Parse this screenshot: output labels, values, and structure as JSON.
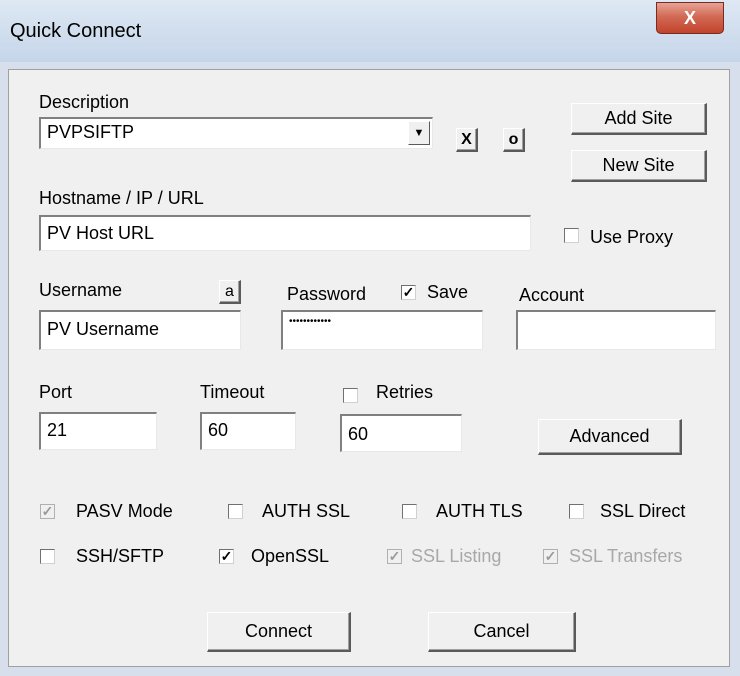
{
  "window": {
    "title": "Quick Connect",
    "close_glyph": "X"
  },
  "description": {
    "label": "Description",
    "value": "PVPSIFTP",
    "delete_label": "X",
    "other_label": "o"
  },
  "buttons": {
    "add_site": "Add Site",
    "new_site": "New Site",
    "advanced": "Advanced",
    "connect": "Connect",
    "cancel": "Cancel",
    "user_a": "a"
  },
  "hostname": {
    "label": "Hostname / IP / URL",
    "value": "PV Host URL",
    "use_proxy_label": "Use Proxy",
    "use_proxy_checked": false
  },
  "credentials": {
    "username_label": "Username",
    "username_value": "PV Username",
    "password_label": "Password",
    "password_value": "••••••••••••",
    "save_label": "Save",
    "save_checked": true,
    "account_label": "Account",
    "account_value": ""
  },
  "connection": {
    "port_label": "Port",
    "port_value": "21",
    "timeout_label": "Timeout",
    "timeout_value": "60",
    "retries_label": "Retries",
    "retries_checked": false,
    "retries_value": "60"
  },
  "options": {
    "pasv_mode": {
      "label": "PASV Mode",
      "checked": true,
      "enabled": false
    },
    "auth_ssl": {
      "label": "AUTH SSL",
      "checked": false,
      "enabled": true
    },
    "auth_tls": {
      "label": "AUTH TLS",
      "checked": false,
      "enabled": true
    },
    "ssl_direct": {
      "label": "SSL Direct",
      "checked": false,
      "enabled": true
    },
    "ssh_sftp": {
      "label": "SSH/SFTP",
      "checked": false,
      "enabled": true
    },
    "openssl": {
      "label": "OpenSSL",
      "checked": true,
      "enabled": true
    },
    "ssl_listing": {
      "label": "SSL Listing",
      "checked": true,
      "enabled": false
    },
    "ssl_transfers": {
      "label": "SSL Transfers",
      "checked": true,
      "enabled": false
    }
  },
  "glyphs": {
    "check": "✓",
    "combo_arrow": "▼"
  },
  "colors": {
    "titlebar": "#d2dfee",
    "close": "#c2432b",
    "dialog_bg": "#f0f0f0",
    "disabled_text": "#a8a8a8"
  }
}
